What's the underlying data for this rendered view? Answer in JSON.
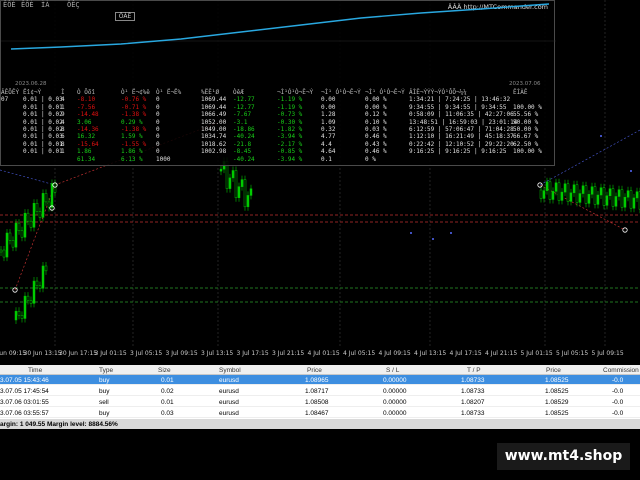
{
  "panel": {
    "tabs": [
      "ÊÔÈ",
      "ÊÔÈ",
      "ÌÀ",
      "ÔÊÇ"
    ],
    "active_tab": "ÔÀÊ",
    "site": "ÄÂÄ http://MTCommander.com",
    "equity_start_date": "2023.06.28",
    "equity_end_date": "2023.07.06",
    "headers": [
      "ÂÊÔÊÝ",
      "Ëî¢¬Ý",
      "Ì",
      "Ò Ôõî",
      "Ò¹ Ë¬¢%ë",
      "Ò¹ Ë¬Ë%",
      "%ËÊ¹Ø",
      "ÒêÆ",
      "¬Ì¹Ó¹Ò¬Ê¬Ý",
      "¬Ì¹ Ó¹Ò¬Ê¬Ý",
      "¬Ì¹ Ó¹Ò¬Ê¬Ý",
      "ÂÌÊ¬ÝÝÝ¬ÝÒ¹ÔÕ¬¼¼",
      "ÊÌÀÊ"
    ],
    "rows": [
      [
        "07",
        "0.01 | 0.03",
        "4",
        "-8.10",
        "-0.76 %",
        "0",
        "1069.44",
        "-12.77",
        "-1.19 %",
        "0.00",
        "0.00 %",
        "1:34:21 | 7:24:25 | 13:46:32",
        ""
      ],
      [
        "",
        "0.01 | 0.01",
        "1",
        "-7.56",
        "-0.71 %",
        "0",
        "1069.44",
        "-12.77",
        "-1.19 %",
        "0.00",
        "0.00 %",
        "9:34:55 | 9:34:55 | 9:34:55",
        "100.00 %"
      ],
      [
        "",
        "0.01 | 0.02",
        "9",
        "-14.48",
        "-1.38 %",
        "0",
        "1066.49",
        "-7.67",
        "-0.73 %",
        "1.28",
        "0.12 %",
        "0:58:09 | 11:06:35 | 42:27:06",
        "55.56 %"
      ],
      [
        "",
        "0.01 | 0.02",
        "4",
        "3.06",
        "0.29 %",
        "0",
        "1052.00",
        "-3.1",
        "-0.30 %",
        "1.09",
        "0.10 %",
        "13:48:51 | 16:59:03 | 23:01:14",
        "50.00 %"
      ],
      [
        "",
        "0.01 | 0.02",
        "8",
        "-14.36",
        "-1.38 %",
        "0",
        "1049.00",
        "-18.86",
        "-1.82 %",
        "0.32",
        "0.03 %",
        "6:12:59 | 57:06:47 | 71:04:28",
        "50.00 %"
      ],
      [
        "",
        "0.01 | 0.03",
        "6",
        "16.32",
        "1.59 %",
        "0",
        "1034.74",
        "-40.24",
        "-3.94 %",
        "4.77",
        "0.46 %",
        "1:12:10 | 16:21:49 | 45:18:37",
        "66.67 %"
      ],
      [
        "",
        "0.01 | 0.01",
        "8",
        "-15.64",
        "-1.55 %",
        "0",
        "1018.62",
        "-21.8",
        "-2.17 %",
        "4.4",
        "0.43 %",
        "0:22:42 | 12:10:52 | 29:22:20",
        "62.50 %"
      ],
      [
        "",
        "0.01 | 0.01",
        "1",
        "1.86",
        "1.86 %",
        "0",
        "1002.98",
        "-8.45",
        "-0.85 %",
        "4.64",
        "0.46 %",
        "9:16:25 | 9:16:25 | 9:16:25",
        "100.00 %"
      ],
      [
        "",
        "",
        "",
        "61.34",
        "6.13 %",
        "1000",
        "",
        "-40.24",
        "-3.94 %",
        "0.1",
        "0 %",
        "",
        ""
      ]
    ]
  },
  "time_axis": [
    "30 Jun 09:15",
    "30 Jun 13:15",
    "30 Jun 17:15",
    "3 Jul 01:15",
    "3 Jul 05:15",
    "3 Jul 09:15",
    "3 Jul 13:15",
    "3 Jul 17:15",
    "3 Jul 21:15",
    "4 Jul 01:15",
    "4 Jul 05:15",
    "4 Jul 09:15",
    "4 Jul 13:15",
    "4 Jul 17:15",
    "4 Jul 21:15",
    "5 Jul 01:15",
    "5 Jul 05:15",
    "5 Jul 09:15"
  ],
  "terminal": {
    "columns": [
      "Time",
      "Type",
      "Size",
      "Symbol",
      "Price",
      "S / L",
      "T / P",
      "Price",
      "Commission"
    ],
    "rows": [
      [
        "3.07.05 15:43:46",
        "buy",
        "0.01",
        "eurusd",
        "1.08965",
        "0.00000",
        "1.08733",
        "1.08525",
        "-0.0"
      ],
      [
        "3.07.05 17:45:54",
        "buy",
        "0.02",
        "eurusd",
        "1.08717",
        "0.00000",
        "1.08733",
        "1.08525",
        "-0.0"
      ],
      [
        "3.07.06 03:01:55",
        "sell",
        "0.01",
        "eurusd",
        "1.08508",
        "0.00000",
        "1.08207",
        "1.08529",
        "-0.0"
      ],
      [
        "3.07.06 03:55:57",
        "buy",
        "0.03",
        "eurusd",
        "1.08467",
        "0.00000",
        "1.08733",
        "1.08525",
        "-0.0"
      ]
    ],
    "selected_row": 0,
    "balance_line": "argin: 1 049.55  Margin level: 8884.56%"
  },
  "watermark": "www.mt4.shop",
  "colors": {
    "bull": "#00d000",
    "bear": "#008000",
    "equity": "#29a8e0",
    "red_text": "#e01010",
    "green_text": "#18d018",
    "selected": "#3d8ee0"
  }
}
